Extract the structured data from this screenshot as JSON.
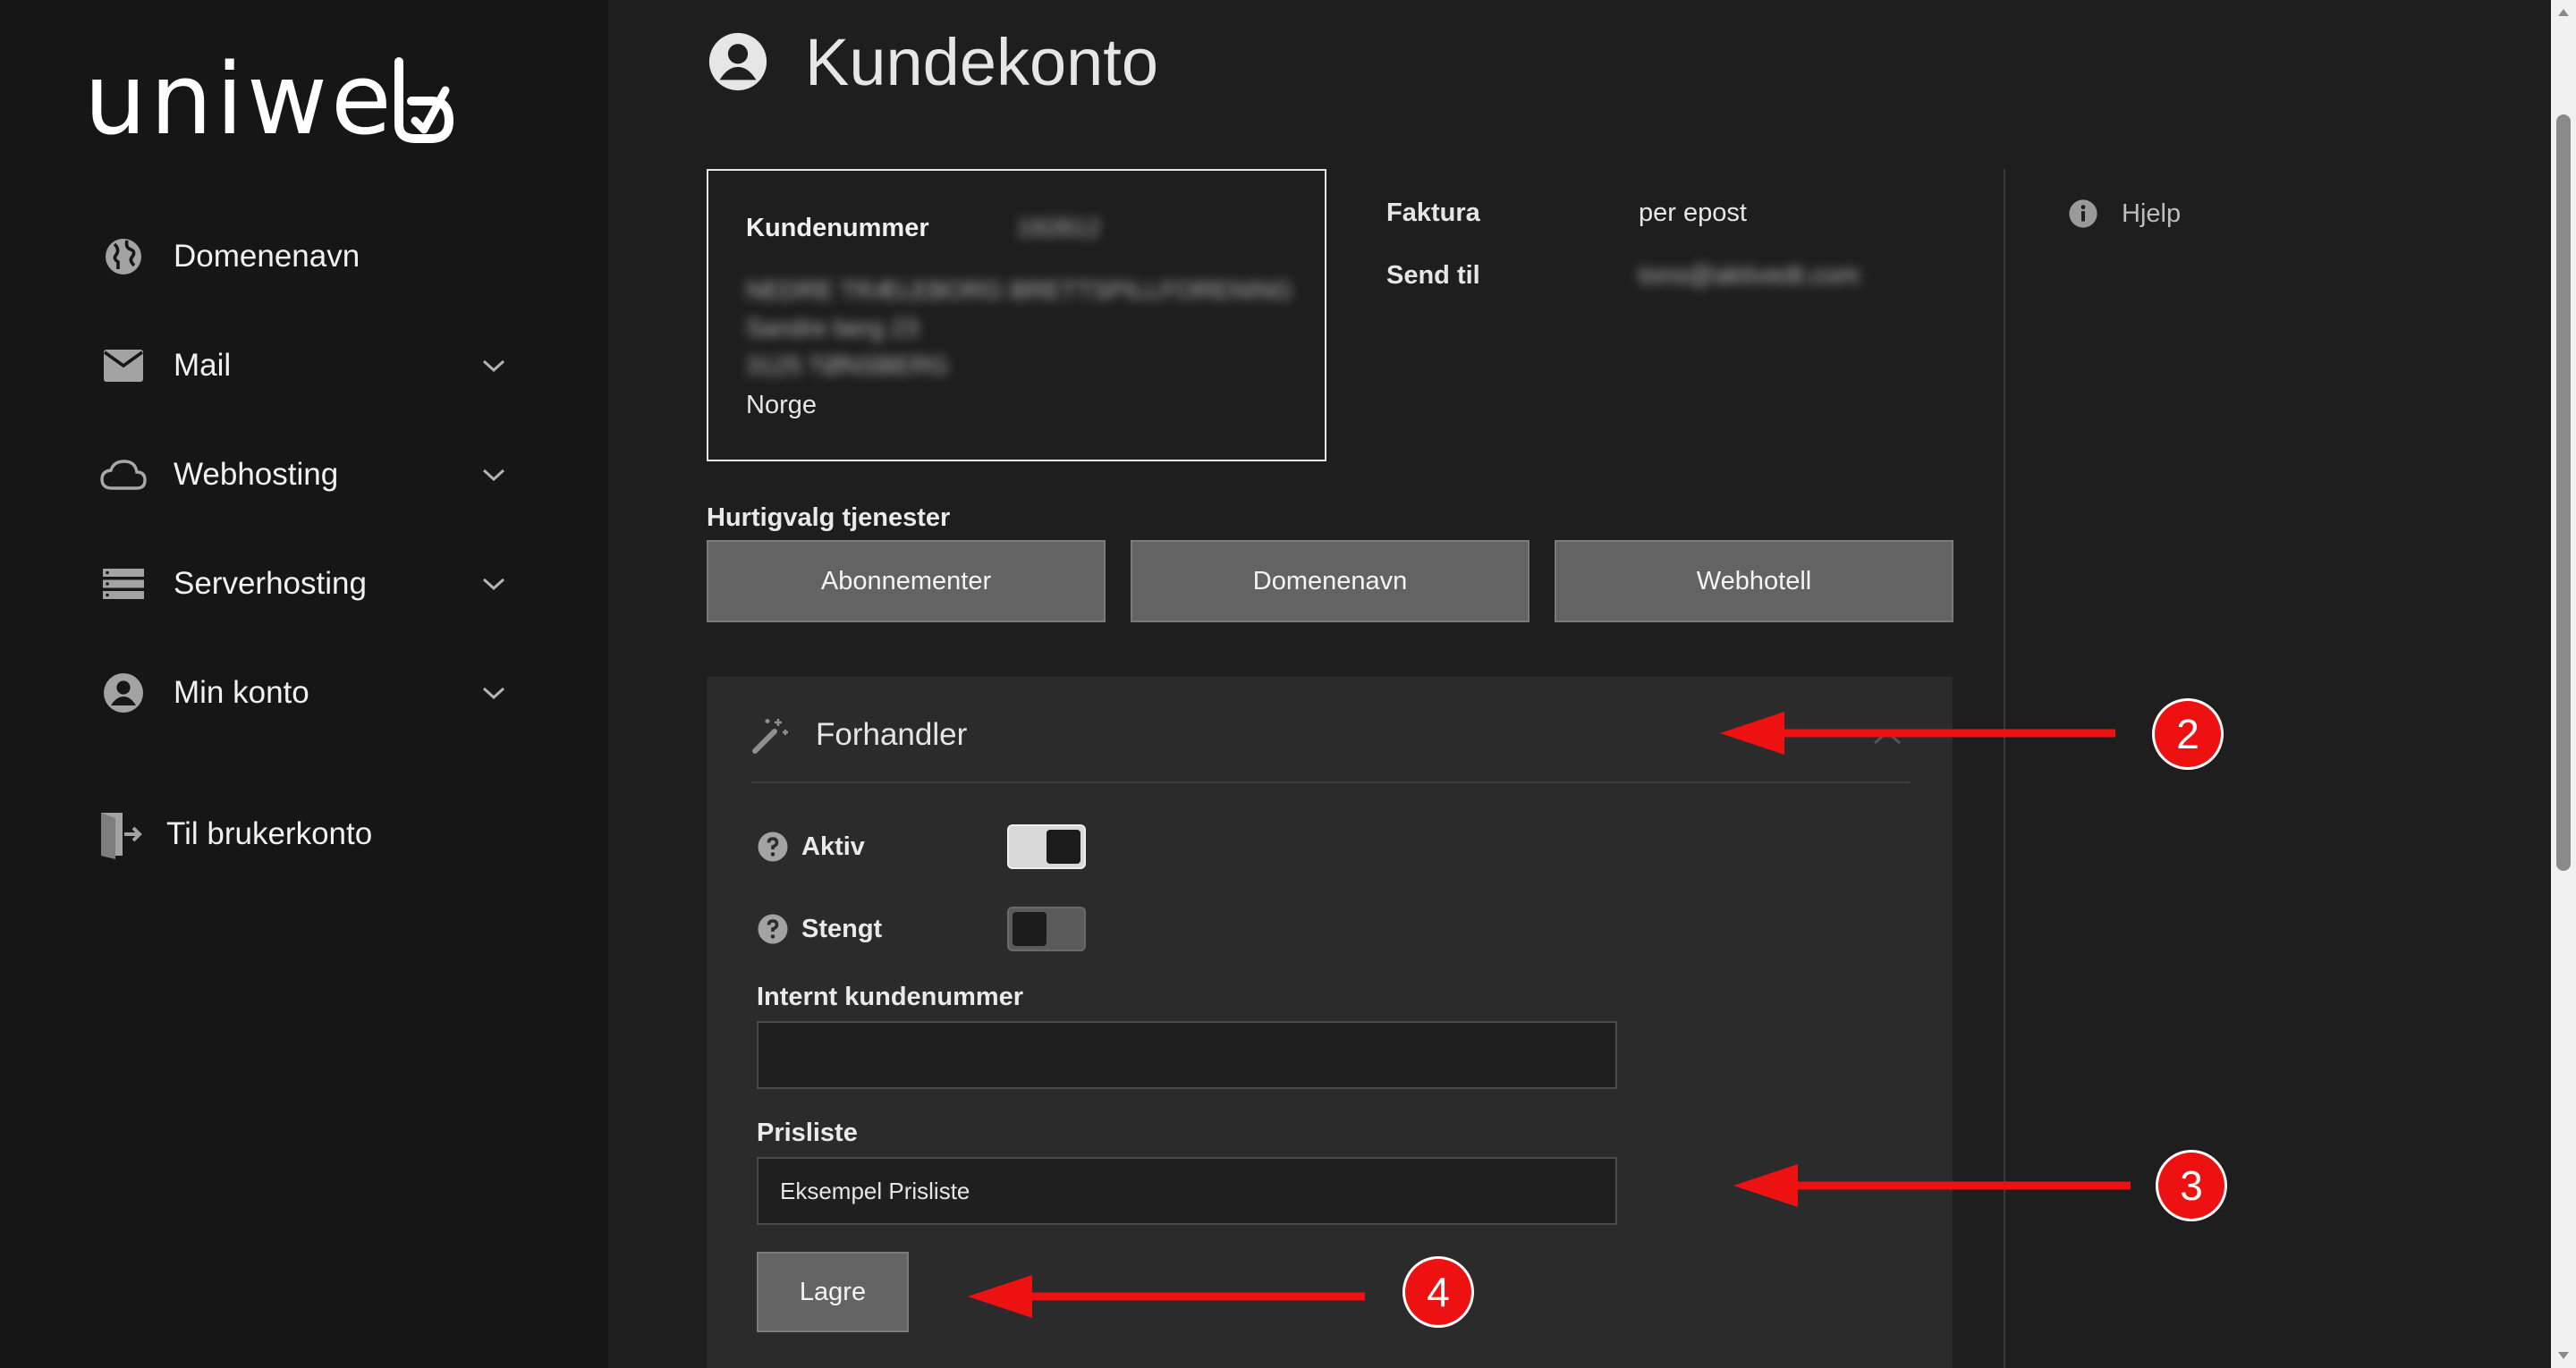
{
  "brand": {
    "logo_text": "uniwe",
    "logo_suffix": "b"
  },
  "sidebar": {
    "items": [
      {
        "label": "Domenenavn",
        "icon": "globe-icon",
        "expandable": false
      },
      {
        "label": "Mail",
        "icon": "mail-icon",
        "expandable": true
      },
      {
        "label": "Webhosting",
        "icon": "cloud-icon",
        "expandable": true
      },
      {
        "label": "Serverhosting",
        "icon": "server-icon",
        "expandable": true
      },
      {
        "label": "Min konto",
        "icon": "account-circle-icon",
        "expandable": true
      }
    ],
    "exit": {
      "label": "Til brukerkonto",
      "icon": "exit-door-icon"
    }
  },
  "page": {
    "title": "Kundekonto",
    "icon": "account-circle-icon"
  },
  "customer": {
    "number_label": "Kundenummer",
    "number_value": "192812",
    "name": "NEDRE TRÆLEBORG BRETTSPILLFORENING",
    "street": "Sandre berg 23",
    "postal": "3125 TØNSBERG",
    "country": "Norge"
  },
  "billing": {
    "invoice_label": "Faktura",
    "invoice_value": "per epost",
    "send_to_label": "Send til",
    "send_to_value": "tons@aktivedt.com"
  },
  "help": {
    "label": "Hjelp",
    "icon": "info-icon"
  },
  "quick": {
    "title": "Hurtigvalg tjenester",
    "buttons": [
      "Abonnementer",
      "Domenenavn",
      "Webhotell"
    ]
  },
  "reseller": {
    "title": "Forhandler",
    "icon": "magic-wand-icon",
    "active_label": "Aktiv",
    "active_on": true,
    "closed_label": "Stengt",
    "closed_on": false,
    "internal_number_label": "Internt kundenummer",
    "internal_number_value": "",
    "pricelist_label": "Prisliste",
    "pricelist_value": "Eksempel Prisliste",
    "save_label": "Lagre"
  },
  "annotations": [
    "2",
    "3",
    "4"
  ],
  "colors": {
    "annotation_red": "#ee1111",
    "sidebar_bg": "#161616",
    "main_bg": "#1e1e1e",
    "panel_bg": "#2b2b2b"
  }
}
